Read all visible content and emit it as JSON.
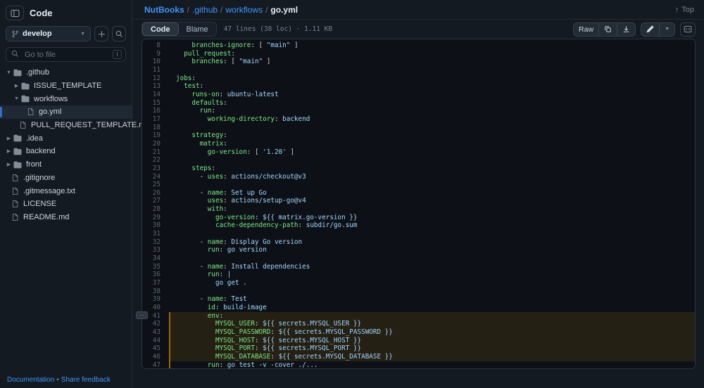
{
  "colors": {
    "accent_link_blue": "#4493f8",
    "yaml_key_green": "#7ee787",
    "yaml_string_blue": "#a5d6ff",
    "selected_bar_blue": "#316dca",
    "highlight_border_yellow": "#9e6a03",
    "panel_bg": "#0d1117",
    "chrome_bg": "#141a22"
  },
  "icons": [
    "panel-toggle-icon",
    "git-branch-icon",
    "chevron-down-icon",
    "chevron-right-icon",
    "plus-icon",
    "search-icon",
    "folder-icon",
    "file-icon",
    "up-arrow-icon",
    "copy-icon",
    "download-icon",
    "pencil-icon",
    "symbols-panel-icon",
    "ellipsis-icon"
  ],
  "sidebar": {
    "header": {
      "title": "Code"
    },
    "branch": {
      "name": "develop"
    },
    "goto": {
      "placeholder": "Go to file",
      "shortcut": "t"
    },
    "tree": [
      {
        "label": ".github",
        "kind": "dir",
        "level": 0,
        "chevron": "down"
      },
      {
        "label": "ISSUE_TEMPLATE",
        "kind": "dir",
        "level": 1,
        "chevron": "right"
      },
      {
        "label": "workflows",
        "kind": "dir",
        "level": 1,
        "chevron": "down"
      },
      {
        "label": "go.yml",
        "kind": "file",
        "level": 2,
        "selected": true
      },
      {
        "label": "PULL_REQUEST_TEMPLATE.md",
        "kind": "file",
        "level": 1
      },
      {
        "label": ".idea",
        "kind": "dir",
        "level": 0,
        "chevron": "right"
      },
      {
        "label": "backend",
        "kind": "dir",
        "level": 0,
        "chevron": "right"
      },
      {
        "label": "front",
        "kind": "dir",
        "level": 0,
        "chevron": "right"
      },
      {
        "label": ".gitignore",
        "kind": "file",
        "level": 0
      },
      {
        "label": ".gitmessage.txt",
        "kind": "file",
        "level": 0
      },
      {
        "label": "LICENSE",
        "kind": "file",
        "level": 0
      },
      {
        "label": "README.md",
        "kind": "file",
        "level": 0
      }
    ],
    "footer": {
      "documentation": "Documentation",
      "separator": "•",
      "feedback": "Share feedback"
    }
  },
  "breadcrumb": {
    "segments": [
      {
        "label": "NutBooks"
      },
      {
        "label": ".github"
      },
      {
        "label": "workflows"
      },
      {
        "label": "go.yml"
      }
    ],
    "separator": "/",
    "top_label": "Top"
  },
  "toolbar": {
    "tabs": [
      {
        "label": "Code"
      },
      {
        "label": "Blame"
      }
    ],
    "active_tab": "Code",
    "meta": "47 lines (38 loc) · 1.11 KB",
    "raw_label": "Raw"
  },
  "code": {
    "file": "go.yml",
    "first_line": 8,
    "lines": [
      {
        "n": 8,
        "t": [
          [
            "p",
            "    "
          ],
          [
            "k",
            "branches-ignore"
          ],
          [
            "p",
            ": [ "
          ],
          [
            "s",
            "\"main\""
          ],
          [
            "p",
            " ]"
          ]
        ]
      },
      {
        "n": 9,
        "t": [
          [
            "p",
            "  "
          ],
          [
            "k",
            "pull_request"
          ],
          [
            "p",
            ":"
          ]
        ]
      },
      {
        "n": 10,
        "t": [
          [
            "p",
            "    "
          ],
          [
            "k",
            "branches"
          ],
          [
            "p",
            ": [ "
          ],
          [
            "s",
            "\"main\""
          ],
          [
            "p",
            " ]"
          ]
        ]
      },
      {
        "n": 11,
        "t": []
      },
      {
        "n": 12,
        "t": [
          [
            "k",
            "jobs"
          ],
          [
            "p",
            ":"
          ]
        ]
      },
      {
        "n": 13,
        "t": [
          [
            "p",
            "  "
          ],
          [
            "k",
            "test"
          ],
          [
            "p",
            ":"
          ]
        ]
      },
      {
        "n": 14,
        "t": [
          [
            "p",
            "    "
          ],
          [
            "k",
            "runs-on"
          ],
          [
            "p",
            ": "
          ],
          [
            "s",
            "ubuntu-latest"
          ]
        ]
      },
      {
        "n": 15,
        "t": [
          [
            "p",
            "    "
          ],
          [
            "k",
            "defaults"
          ],
          [
            "p",
            ":"
          ]
        ]
      },
      {
        "n": 16,
        "t": [
          [
            "p",
            "      "
          ],
          [
            "k",
            "run"
          ],
          [
            "p",
            ":"
          ]
        ]
      },
      {
        "n": 17,
        "t": [
          [
            "p",
            "        "
          ],
          [
            "k",
            "working-directory"
          ],
          [
            "p",
            ": "
          ],
          [
            "s",
            "backend"
          ]
        ]
      },
      {
        "n": 18,
        "t": []
      },
      {
        "n": 19,
        "t": [
          [
            "p",
            "    "
          ],
          [
            "k",
            "strategy"
          ],
          [
            "p",
            ":"
          ]
        ]
      },
      {
        "n": 20,
        "t": [
          [
            "p",
            "      "
          ],
          [
            "k",
            "matrix"
          ],
          [
            "p",
            ":"
          ]
        ]
      },
      {
        "n": 21,
        "t": [
          [
            "p",
            "        "
          ],
          [
            "k",
            "go-version"
          ],
          [
            "p",
            ": [ "
          ],
          [
            "s",
            "'1.20'"
          ],
          [
            "p",
            " ]"
          ]
        ]
      },
      {
        "n": 22,
        "t": []
      },
      {
        "n": 23,
        "t": [
          [
            "p",
            "    "
          ],
          [
            "k",
            "steps"
          ],
          [
            "p",
            ":"
          ]
        ]
      },
      {
        "n": 24,
        "t": [
          [
            "p",
            "      - "
          ],
          [
            "k",
            "uses"
          ],
          [
            "p",
            ": "
          ],
          [
            "s",
            "actions/checkout@v3"
          ]
        ]
      },
      {
        "n": 25,
        "t": []
      },
      {
        "n": 26,
        "t": [
          [
            "p",
            "      - "
          ],
          [
            "k",
            "name"
          ],
          [
            "p",
            ": "
          ],
          [
            "s",
            "Set up Go"
          ]
        ]
      },
      {
        "n": 27,
        "t": [
          [
            "p",
            "        "
          ],
          [
            "k",
            "uses"
          ],
          [
            "p",
            ": "
          ],
          [
            "s",
            "actions/setup-go@v4"
          ]
        ]
      },
      {
        "n": 28,
        "t": [
          [
            "p",
            "        "
          ],
          [
            "k",
            "with"
          ],
          [
            "p",
            ":"
          ]
        ]
      },
      {
        "n": 29,
        "t": [
          [
            "p",
            "          "
          ],
          [
            "k",
            "go-version"
          ],
          [
            "p",
            ": "
          ],
          [
            "s",
            "${{ matrix.go-version }}"
          ]
        ]
      },
      {
        "n": 30,
        "t": [
          [
            "p",
            "          "
          ],
          [
            "k",
            "cache-dependency-path"
          ],
          [
            "p",
            ": "
          ],
          [
            "s",
            "subdir/go.sum"
          ]
        ]
      },
      {
        "n": 31,
        "t": []
      },
      {
        "n": 32,
        "t": [
          [
            "p",
            "      - "
          ],
          [
            "k",
            "name"
          ],
          [
            "p",
            ": "
          ],
          [
            "s",
            "Display Go version"
          ]
        ]
      },
      {
        "n": 33,
        "t": [
          [
            "p",
            "        "
          ],
          [
            "k",
            "run"
          ],
          [
            "p",
            ": "
          ],
          [
            "s",
            "go version"
          ]
        ]
      },
      {
        "n": 34,
        "t": []
      },
      {
        "n": 35,
        "t": [
          [
            "p",
            "      - "
          ],
          [
            "k",
            "name"
          ],
          [
            "p",
            ": "
          ],
          [
            "s",
            "Install dependencies"
          ]
        ]
      },
      {
        "n": 36,
        "t": [
          [
            "p",
            "        "
          ],
          [
            "k",
            "run"
          ],
          [
            "p",
            ": "
          ],
          [
            "s",
            "|"
          ]
        ]
      },
      {
        "n": 37,
        "t": [
          [
            "p",
            "          "
          ],
          [
            "s",
            "go get ."
          ]
        ]
      },
      {
        "n": 38,
        "t": []
      },
      {
        "n": 39,
        "t": [
          [
            "p",
            "      - "
          ],
          [
            "k",
            "name"
          ],
          [
            "p",
            ": "
          ],
          [
            "s",
            "Test"
          ]
        ]
      },
      {
        "n": 40,
        "t": [
          [
            "p",
            "        "
          ],
          [
            "k",
            "id"
          ],
          [
            "p",
            ": "
          ],
          [
            "s",
            "build-image"
          ]
        ]
      },
      {
        "n": 41,
        "hl": 1,
        "t": [
          [
            "p",
            "        "
          ],
          [
            "k",
            "env"
          ],
          [
            "p",
            ":"
          ]
        ]
      },
      {
        "n": 42,
        "hl": 1,
        "t": [
          [
            "p",
            "          "
          ],
          [
            "k",
            "MYSQL_USER"
          ],
          [
            "p",
            ": "
          ],
          [
            "s",
            "${{ secrets.MYSQL_USER }}"
          ]
        ]
      },
      {
        "n": 43,
        "hl": 1,
        "t": [
          [
            "p",
            "          "
          ],
          [
            "k",
            "MYSQL_PASSWORD"
          ],
          [
            "p",
            ": "
          ],
          [
            "s",
            "${{ secrets.MYSQL_PASSWORD }}"
          ]
        ]
      },
      {
        "n": 44,
        "hl": 1,
        "t": [
          [
            "p",
            "          "
          ],
          [
            "k",
            "MYSQL_HOST"
          ],
          [
            "p",
            ": "
          ],
          [
            "s",
            "${{ secrets.MYSQL_HOST }}"
          ]
        ]
      },
      {
        "n": 45,
        "hl": 1,
        "t": [
          [
            "p",
            "          "
          ],
          [
            "k",
            "MYSQL_PORT"
          ],
          [
            "p",
            ": "
          ],
          [
            "s",
            "${{ secrets.MYSQL_PORT }}"
          ]
        ]
      },
      {
        "n": 46,
        "hl": 1,
        "t": [
          [
            "p",
            "          "
          ],
          [
            "k",
            "MYSQL_DATABASE"
          ],
          [
            "p",
            ": "
          ],
          [
            "s",
            "${{ secrets.MYSQL_DATABASE }}"
          ]
        ]
      },
      {
        "n": 47,
        "hl": 2,
        "t": [
          [
            "p",
            "        "
          ],
          [
            "k",
            "run"
          ],
          [
            "p",
            ": "
          ],
          [
            "s",
            "go test -v -cover ./..."
          ]
        ]
      }
    ],
    "highlight_menu_button": "···"
  }
}
